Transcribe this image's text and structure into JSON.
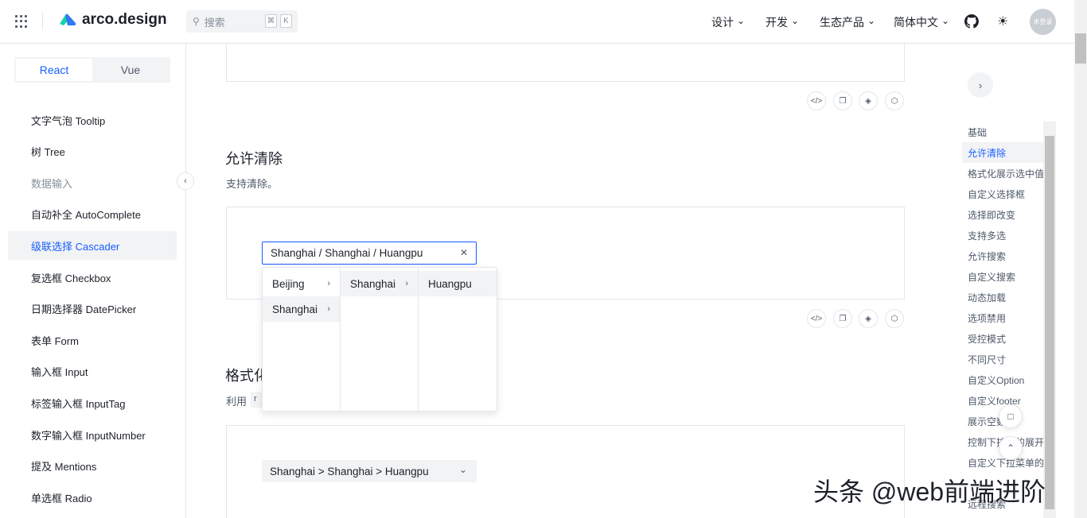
{
  "header": {
    "logo": "arco.design",
    "search_placeholder": "搜索",
    "kbd_cmd": "⌘",
    "kbd_k": "K",
    "nav": [
      "设计",
      "开发",
      "生态产品",
      "简体中文"
    ],
    "avatar": "未登录"
  },
  "sidebar": {
    "framework_tabs": [
      "React",
      "Vue"
    ],
    "active_framework": "React",
    "items": [
      {
        "label": "文字气泡 Tooltip"
      },
      {
        "label": "树 Tree"
      },
      {
        "label": "数据输入",
        "group": true
      },
      {
        "label": "自动补全 AutoComplete"
      },
      {
        "label": "级联选择 Cascader",
        "active": true
      },
      {
        "label": "复选框 Checkbox"
      },
      {
        "label": "日期选择器 DatePicker"
      },
      {
        "label": "表单 Form"
      },
      {
        "label": "输入框 Input"
      },
      {
        "label": "标签输入框 InputTag"
      },
      {
        "label": "数字输入框 InputNumber"
      },
      {
        "label": "提及 Mentions"
      },
      {
        "label": "单选框 Radio"
      }
    ]
  },
  "main": {
    "section_clear": {
      "title": "允许清除",
      "desc": "支持清除。",
      "value": "Shanghai / Shanghai / Huangpu"
    },
    "dropdown": {
      "col1": [
        "Beijing",
        "Shanghai"
      ],
      "col2": [
        "Shanghai"
      ],
      "col3": [
        "Huangpu"
      ]
    },
    "section_format": {
      "title": "格式化",
      "desc": "利用",
      "code": "r",
      "value": "Shanghai > Shanghai > Huangpu"
    }
  },
  "toc": {
    "items": [
      "基础",
      "允许清除",
      "格式化展示选中值",
      "自定义选择框",
      "选择即改变",
      "支持多选",
      "允许搜索",
      "自定义搜索",
      "动态加载",
      "选项禁用",
      "受控模式",
      "不同尺寸",
      "自定义Option",
      "自定义footer",
      "展示空数据",
      "控制下拉框的展开",
      "自定义下拉菜单的",
      "",
      "远程搜索"
    ],
    "active": "允许清除"
  },
  "watermark": "头条 @web前端进阶",
  "colors": {
    "primary": "#165dff",
    "border": "#e5e6eb",
    "fill": "#f2f3f5"
  }
}
